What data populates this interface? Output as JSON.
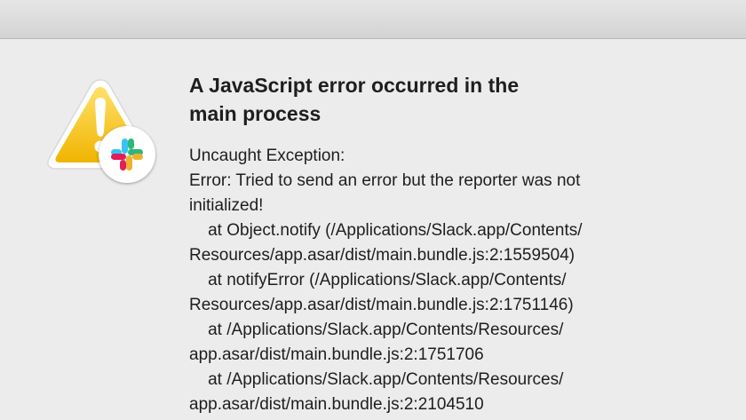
{
  "dialog": {
    "title_line1": "A JavaScript error occurred in the",
    "title_line2": "main process",
    "message_lines": [
      "Uncaught Exception:",
      "Error: Tried to send an error but the reporter was not",
      "initialized!",
      "    at Object.notify (/Applications/Slack.app/Contents/",
      "Resources/app.asar/dist/main.bundle.js:2:1559504)",
      "    at notifyError (/Applications/Slack.app/Contents/",
      "Resources/app.asar/dist/main.bundle.js:2:1751146)",
      "    at /Applications/Slack.app/Contents/Resources/",
      "app.asar/dist/main.bundle.js:2:1751706",
      "    at /Applications/Slack.app/Contents/Resources/",
      "app.asar/dist/main.bundle.js:2:2104510"
    ]
  },
  "icons": {
    "warning": "warning-triangle-icon",
    "app_badge": "slack-logo-icon"
  },
  "colors": {
    "warning_yellow": "#f5c518",
    "slack_blue": "#36c5f0",
    "slack_green": "#2eb67d",
    "slack_yellow": "#ecb22e",
    "slack_red": "#e01e5a"
  }
}
